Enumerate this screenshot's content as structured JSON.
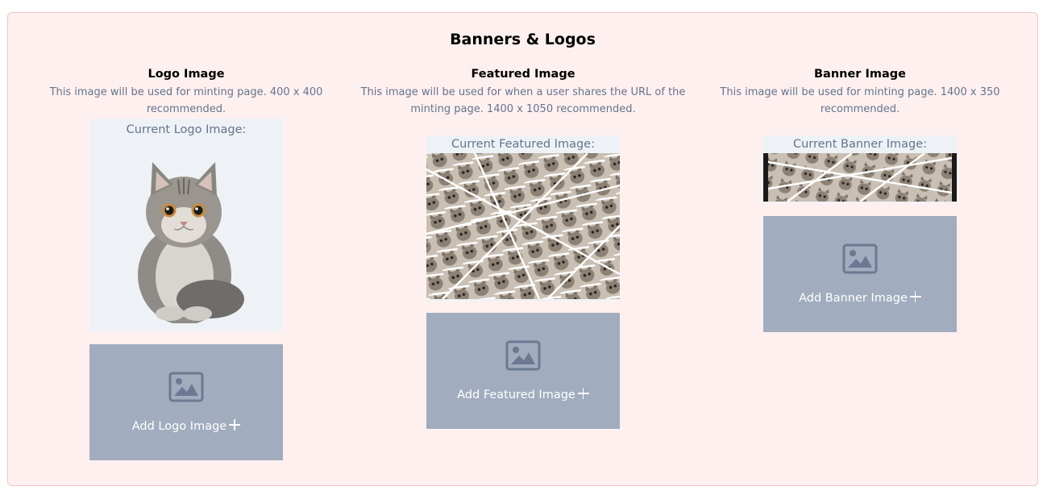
{
  "section": {
    "title": "Banners & Logos"
  },
  "logo": {
    "heading": "Logo Image",
    "description": "This image will be used for minting page. 400 x 400 recommended.",
    "current_label": "Current Logo Image:",
    "add_label": "Add Logo Image"
  },
  "featured": {
    "heading": "Featured Image",
    "description": "This image will be used for when a user shares the URL of the minting page. 1400 x 1050 recommended.",
    "current_label": "Current Featured Image:",
    "add_label": "Add Featured Image"
  },
  "banner": {
    "heading": "Banner Image",
    "description": "This image will be used for minting page. 1400 x 350 recommended.",
    "current_label": "Current Banner Image:",
    "add_label": "Add Banner Image"
  },
  "colors": {
    "panel_bg": "#fff0f0",
    "panel_border": "#f3c4c4",
    "upload_bg": "#a1acbe",
    "upload_icon": "#6b7a92",
    "preview_bg": "#eef2f6"
  },
  "icons": {
    "upload": "image-placeholder-icon",
    "add": "plus-icon"
  }
}
